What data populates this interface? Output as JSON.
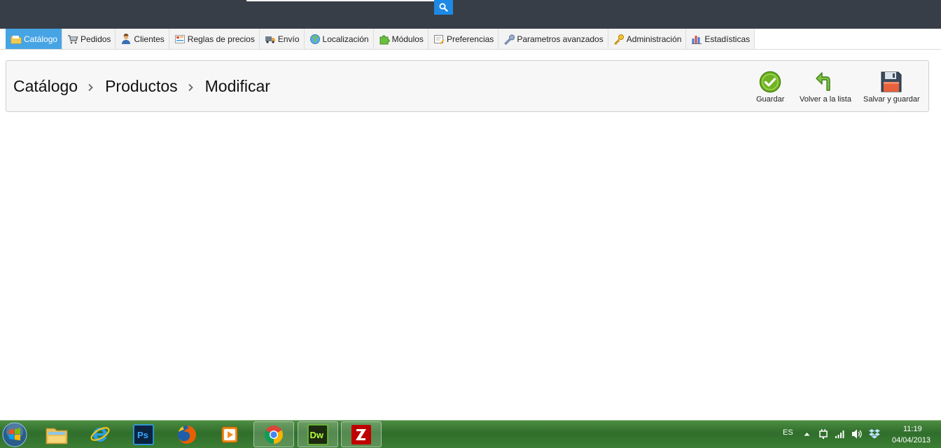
{
  "menu": {
    "items": [
      {
        "label": "Catálogo",
        "icon": "folder-icon",
        "active": true
      },
      {
        "label": "Pedidos",
        "icon": "cart-icon"
      },
      {
        "label": "Clientes",
        "icon": "user-icon"
      },
      {
        "label": "Reglas de precios",
        "icon": "price-rules-icon"
      },
      {
        "label": "Envío",
        "icon": "truck-icon"
      },
      {
        "label": "Localización",
        "icon": "globe-icon"
      },
      {
        "label": "Módulos",
        "icon": "puzzle-icon"
      },
      {
        "label": "Preferencias",
        "icon": "preferences-icon"
      },
      {
        "label": "Parametros avanzados",
        "icon": "wrench-icon"
      },
      {
        "label": "Administración",
        "icon": "key-icon"
      },
      {
        "label": "Estadísticas",
        "icon": "bar-chart-icon"
      }
    ]
  },
  "breadcrumb": {
    "items": [
      "Catálogo",
      "Productos",
      "Modificar"
    ],
    "separator": "›"
  },
  "toolbar": {
    "save_label": "Guardar",
    "back_label": "Volver a la lista",
    "save_stay_label": "Salvar y guardar"
  },
  "taskbar": {
    "apps": [
      "file-explorer-icon",
      "internet-explorer-icon",
      "photoshop-icon",
      "firefox-icon",
      "media-player-icon",
      "chrome-icon",
      "dreamweaver-icon",
      "filezilla-icon"
    ],
    "language": "ES",
    "time": "11:19",
    "date": "04/04/2013"
  },
  "colors": {
    "header": "#383e47",
    "accent": "#47a4e4",
    "search_button": "#1e88e5",
    "save_green": "#6fb322",
    "taskbar": "#3c7e34"
  }
}
